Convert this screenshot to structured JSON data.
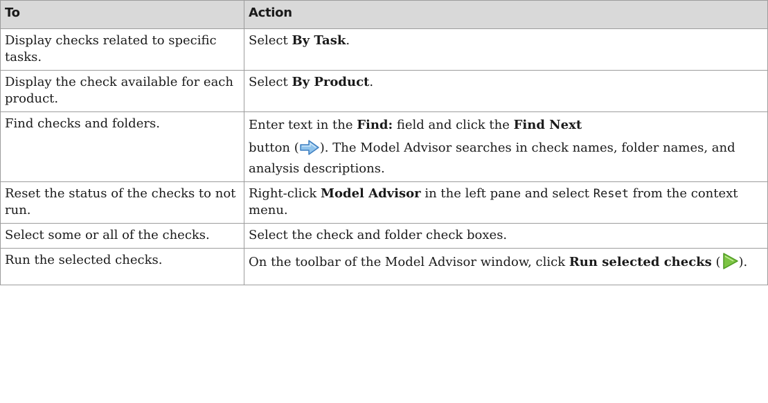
{
  "headers": {
    "to": "To",
    "action": "Action"
  },
  "rows": [
    {
      "to": "Display checks related to specific tasks.",
      "action": {
        "pre": "Select ",
        "bold": "By Task",
        "post": "."
      }
    },
    {
      "to": "Display the check available for each product.",
      "action": {
        "pre": "Select ",
        "bold": "By Product",
        "post": "."
      }
    },
    {
      "to": "Find checks and folders.",
      "action": {
        "t1": "Enter text in the ",
        "b1": "Find:",
        "t2": " field and click the ",
        "b2": "Find Next",
        "t3": "button (",
        "icon": "arrow-right-icon",
        "t4": "). The Model Advisor searches in check names, folder names, and analysis descriptions."
      }
    },
    {
      "to": "Reset the status of the checks to not run.",
      "action": {
        "t1": "Right-click ",
        "b1": "Model Advisor",
        "t2": " in the left pane and select ",
        "code": "Reset",
        "t3": " from the context menu."
      }
    },
    {
      "to": "Select some or all of the checks.",
      "action": {
        "text": "Select the check and folder check boxes."
      }
    },
    {
      "to": "Run the selected checks.",
      "action": {
        "t1": "On the toolbar of the Model Advisor window, click ",
        "b1": "Run selected checks",
        "t2": " (",
        "icon": "play-icon",
        "t3": ")."
      }
    }
  ],
  "colors": {
    "header_bg": "#d9d9d9",
    "border": "#9c9c9c",
    "arrow_fill": "#8fc3ec",
    "arrow_stroke": "#3f7fc0",
    "play_fill": "#7cc443",
    "play_stroke": "#4e9a22"
  }
}
